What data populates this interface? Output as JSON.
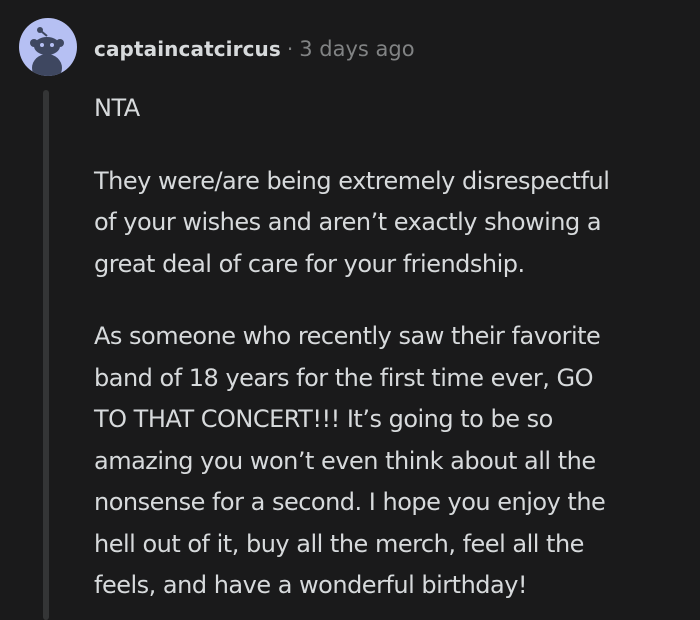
{
  "comment": {
    "avatar_icon": "reddit-snoo-avatar-icon",
    "author": "captaincatcircus",
    "separator": "·",
    "timestamp": "3 days ago",
    "verdict": "NTA",
    "paragraphs": [
      {
        "lines": [
          "They were/are being extremely disrespectful",
          "of your wishes and aren’t exactly showing a",
          "great deal of care for your friendship."
        ]
      },
      {
        "lines": [
          "As someone who recently saw their favorite",
          "band of 18 years for the first time ever, GO",
          "TO THAT CONCERT!!! It’s going to be so",
          "amazing you won’t even think about all the",
          "nonsense for a second. I hope you enjoy the",
          "hell out of it, buy all the merch, feel all the",
          "feels, and have a wonderful birthday!"
        ]
      }
    ]
  },
  "colors": {
    "background": "#1a1a1b",
    "text": "#d7dadc",
    "meta": "#818384",
    "thread_line": "#343536",
    "avatar_bg": "#b6c0f3"
  }
}
